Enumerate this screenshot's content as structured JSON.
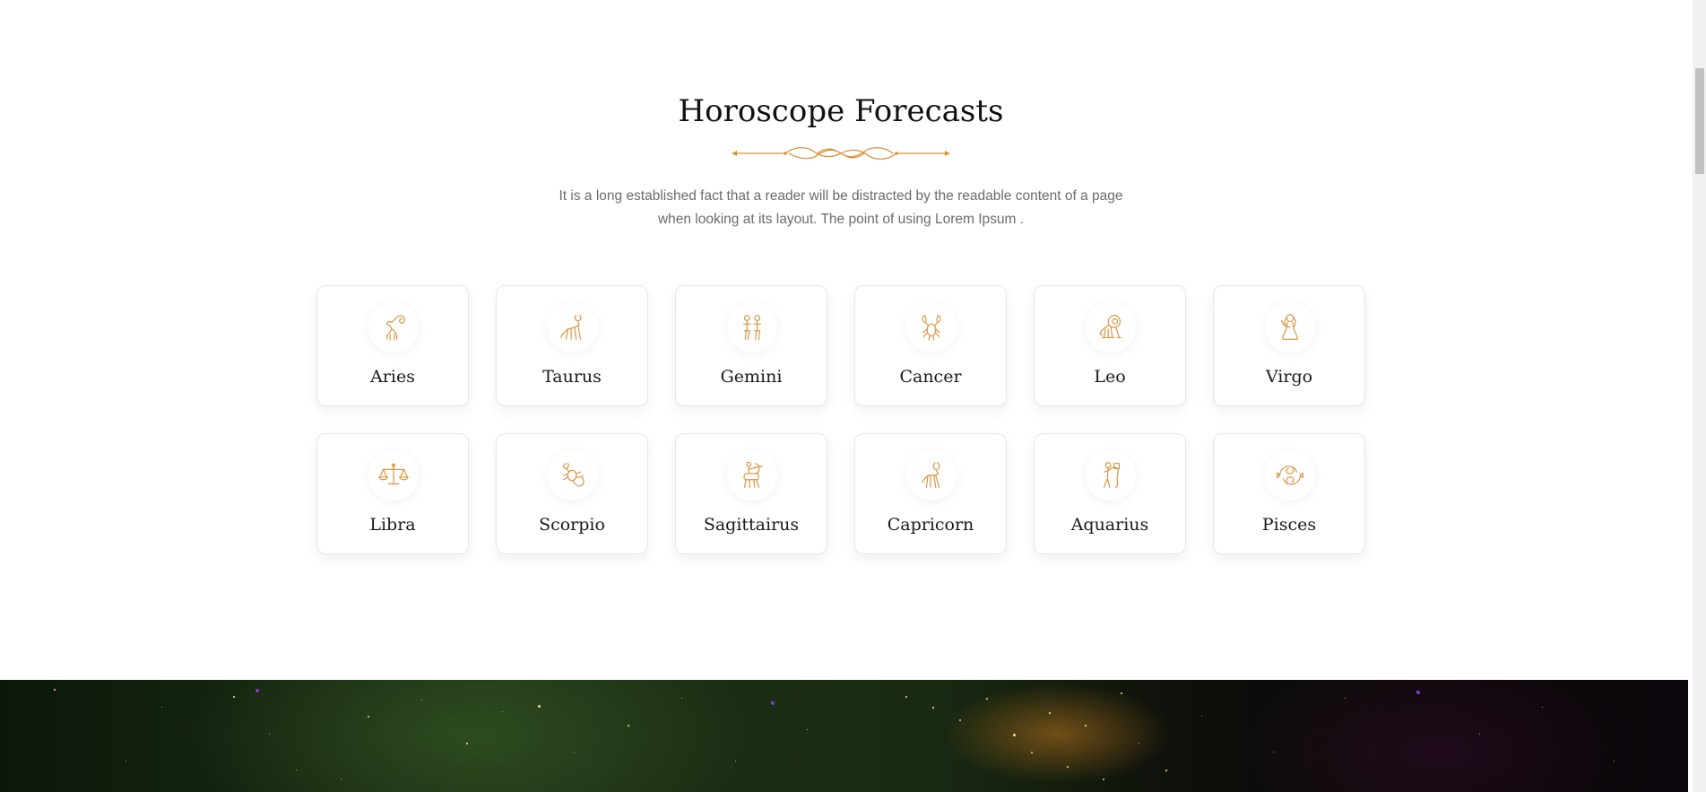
{
  "section": {
    "title": "Horoscope Forecasts",
    "description_line1": "It is a long established fact that a reader will be distracted by the readable content of a page",
    "description_line2": "when looking at its layout. The point of using Lorem Ipsum ."
  },
  "signs": [
    {
      "label": "Aries",
      "icon": "aries-ram-icon"
    },
    {
      "label": "Taurus",
      "icon": "taurus-bull-icon"
    },
    {
      "label": "Gemini",
      "icon": "gemini-twins-icon"
    },
    {
      "label": "Cancer",
      "icon": "cancer-crab-icon"
    },
    {
      "label": "Leo",
      "icon": "leo-lion-icon"
    },
    {
      "label": "Virgo",
      "icon": "virgo-maiden-icon"
    },
    {
      "label": "Libra",
      "icon": "libra-scales-icon"
    },
    {
      "label": "Scorpio",
      "icon": "scorpio-scorpion-icon"
    },
    {
      "label": "Sagittairus",
      "icon": "sagittarius-archer-icon"
    },
    {
      "label": "Capricorn",
      "icon": "capricorn-goat-icon"
    },
    {
      "label": "Aquarius",
      "icon": "aquarius-water-bearer-icon"
    },
    {
      "label": "Pisces",
      "icon": "pisces-fish-icon"
    }
  ],
  "colors": {
    "accent": "#d9923a",
    "title": "#111111",
    "text": "#6b6b6b"
  }
}
